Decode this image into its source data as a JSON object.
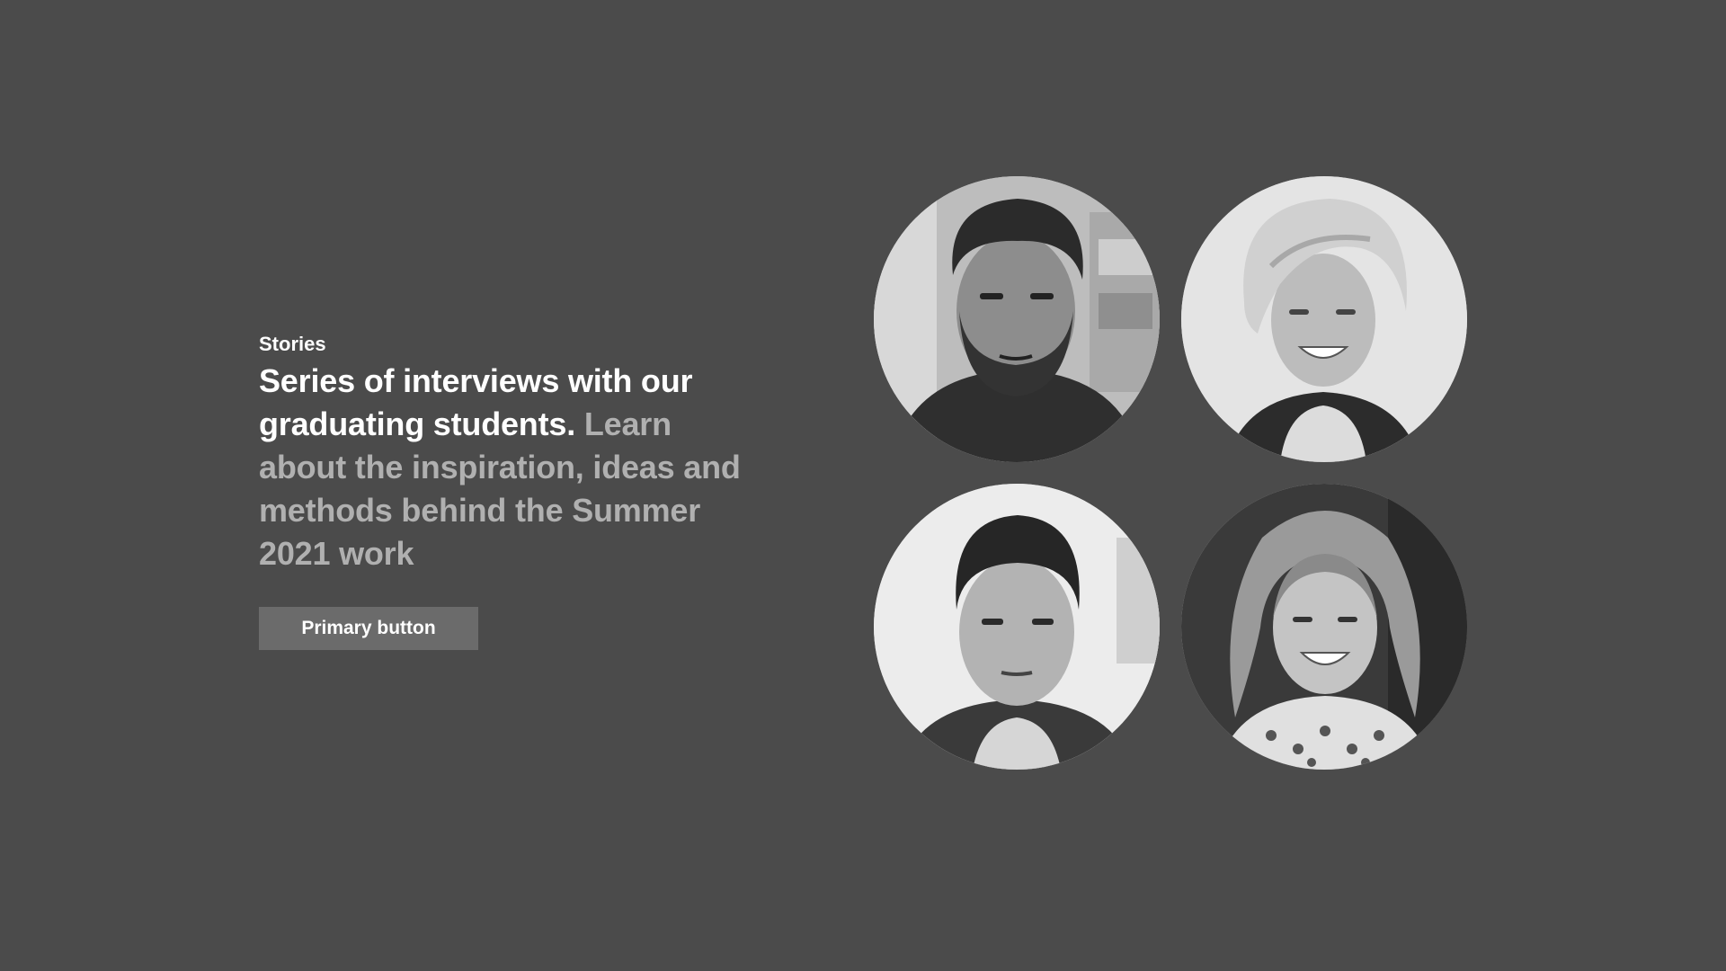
{
  "section": {
    "eyebrow": "Stories",
    "headline_lead": "Series of interviews with our graduating students.",
    "headline_rest": "Learn about the inspiration, ideas and methods behind the Summer 2021 work",
    "primary_button_label": "Primary button"
  },
  "avatars": [
    {
      "icon": "avatar-bearded-man-icon"
    },
    {
      "icon": "avatar-short-hair-woman-icon"
    },
    {
      "icon": "avatar-man-slick-hair-icon"
    },
    {
      "icon": "avatar-long-hair-woman-icon"
    }
  ],
  "colors": {
    "background": "#4b4b4b",
    "text_primary": "#ffffff",
    "text_secondary": "#b0b0b0",
    "button_background": "#6b6b6b"
  }
}
